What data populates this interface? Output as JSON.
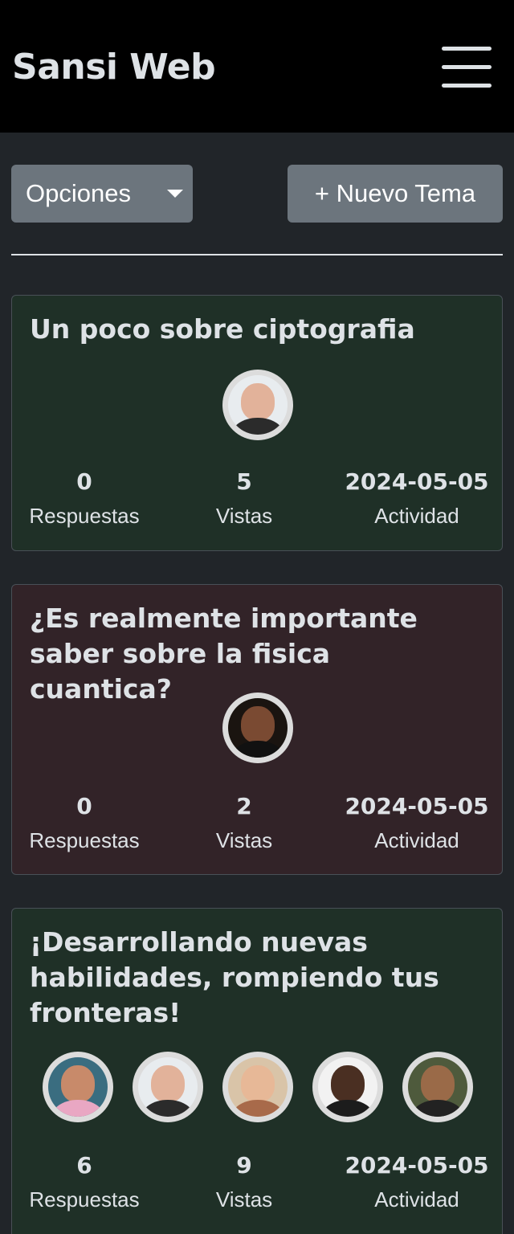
{
  "brand": "Sansi Web",
  "toolbar": {
    "options_label": "Opciones",
    "new_topic_label": "+ Nuevo Tema"
  },
  "topics": [
    {
      "title": "Un poco sobre ciptografia",
      "replies": "0",
      "views": "5",
      "activity": "2024-05-05",
      "replies_label": "Respuestas",
      "views_label": "Vistas",
      "activity_label": "Actividad"
    },
    {
      "title": "¿Es realmente importante saber sobre la fisica cuantica?",
      "replies": "0",
      "views": "2",
      "activity": "2024-05-05",
      "replies_label": "Respuestas",
      "views_label": "Vistas",
      "activity_label": "Actividad"
    },
    {
      "title": "¡Desarrollando nuevas habilidades, rompiendo tus fronteras!",
      "replies": "6",
      "views": "9",
      "activity": "2024-05-05",
      "replies_label": "Respuestas",
      "views_label": "Vistas",
      "activity_label": "Actividad"
    }
  ],
  "colors": {
    "navbar": "#000000",
    "page_bg": "#212529",
    "card_green": "#1f3027",
    "card_red": "#322328",
    "button": "#6c757d"
  }
}
